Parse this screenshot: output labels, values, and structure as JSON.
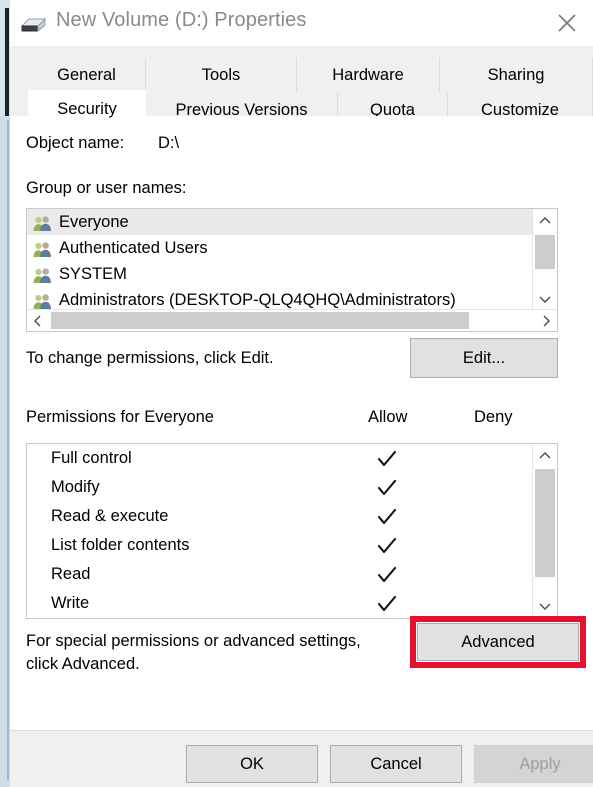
{
  "window": {
    "title": "New Volume (D:) Properties",
    "drive_icon": "hard-drive-icon",
    "close_icon": "close-icon"
  },
  "tabs": {
    "row1": [
      {
        "label": "General",
        "selected": false
      },
      {
        "label": "Tools",
        "selected": false
      },
      {
        "label": "Hardware",
        "selected": false
      },
      {
        "label": "Sharing",
        "selected": false
      }
    ],
    "row2": [
      {
        "label": "Security",
        "selected": true
      },
      {
        "label": "Previous Versions",
        "selected": false
      },
      {
        "label": "Quota",
        "selected": false
      },
      {
        "label": "Customize",
        "selected": false
      }
    ]
  },
  "security": {
    "object_name_label": "Object name:",
    "object_name_value": "D:\\",
    "group_label": "Group or user names:",
    "groups": [
      {
        "name": "Everyone",
        "icon": "users-icon",
        "selected": true
      },
      {
        "name": "Authenticated Users",
        "icon": "users-icon",
        "selected": false
      },
      {
        "name": "SYSTEM",
        "icon": "users-icon",
        "selected": false
      },
      {
        "name": "Administrators (DESKTOP-QLQ4QHQ\\Administrators)",
        "icon": "users-icon",
        "selected": false
      }
    ],
    "edit_hint": "To change permissions, click Edit.",
    "edit_button": "Edit...",
    "permissions_title": "Permissions for Everyone",
    "column_allow": "Allow",
    "column_deny": "Deny",
    "permissions": [
      {
        "name": "Full control",
        "allow": true,
        "deny": false
      },
      {
        "name": "Modify",
        "allow": true,
        "deny": false
      },
      {
        "name": "Read & execute",
        "allow": true,
        "deny": false
      },
      {
        "name": "List folder contents",
        "allow": true,
        "deny": false
      },
      {
        "name": "Read",
        "allow": true,
        "deny": false
      },
      {
        "name": "Write",
        "allow": true,
        "deny": false
      }
    ],
    "advanced_hint_line1": "For special permissions or advanced settings,",
    "advanced_hint_line2": "click Advanced.",
    "advanced_button": "Advanced"
  },
  "footer": {
    "ok": "OK",
    "cancel": "Cancel",
    "apply": "Apply"
  },
  "annotation": {
    "highlight_color": "#e8112d",
    "target": "advanced-button"
  }
}
